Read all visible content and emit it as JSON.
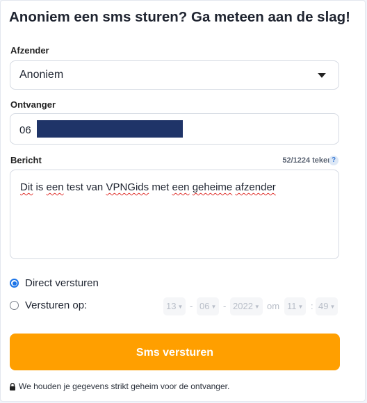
{
  "title": "Anoniem een sms sturen? Ga meteen aan de slag!",
  "sender": {
    "label": "Afzender",
    "selected": "Anoniem"
  },
  "recipient": {
    "label": "Ontvanger",
    "prefix": "06"
  },
  "message": {
    "label": "Bericht",
    "counter": "52/1224 tekens",
    "help": "?",
    "words": [
      "Dit",
      "is",
      "een",
      "test",
      "van",
      "VPNGids",
      "met",
      "een",
      "geheime",
      "afzender"
    ]
  },
  "send_options": {
    "direct_label": "Direct versturen",
    "scheduled_label": "Versturen op:",
    "day": "13",
    "month": "06",
    "year": "2022",
    "at": "om",
    "hour": "11",
    "minute": "49",
    "date_sep": "-",
    "time_sep": ":"
  },
  "submit_label": "Sms versturen",
  "privacy_note": "We houden je gegevens strikt geheim voor de ontvanger.",
  "colors": {
    "accent": "#ff9f00",
    "radio": "#1a73e8",
    "redaction": "#1f3468"
  },
  "icons": {
    "select": "caret-down-icon",
    "help": "question-icon",
    "privacy": "lock-icon"
  }
}
